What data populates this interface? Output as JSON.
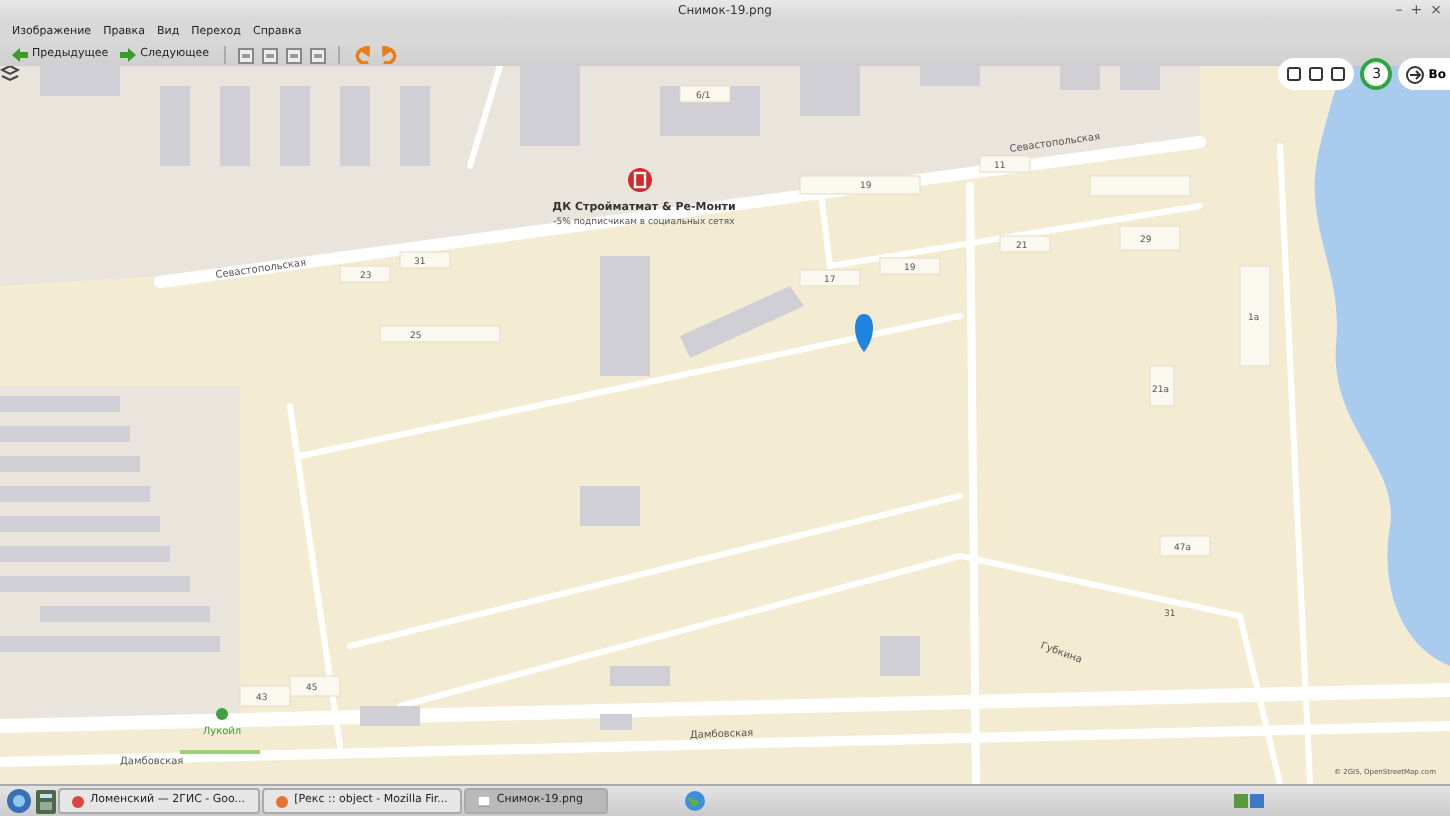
{
  "window": {
    "title": "Снимок-19.png",
    "controls": [
      "–",
      "+",
      "×"
    ]
  },
  "menu": [
    "Изображение",
    "Правка",
    "Вид",
    "Переход",
    "Справка"
  ],
  "toolbar": {
    "buttons": [
      {
        "label": "Предыдущее",
        "kind": "back"
      },
      {
        "label": "Следующее",
        "kind": "forward"
      }
    ]
  },
  "map": {
    "poi": {
      "name": "ДК Стройматмат & Ре-Монти",
      "promo": "-5% подписчикам в социальных сетях"
    },
    "streets": [
      "Севастопольская",
      "Севастопольская",
      "Дамбовская",
      "Дамбовская",
      "Губкина"
    ],
    "buildings": [
      "19",
      "11",
      "17",
      "19",
      "21",
      "25",
      "23",
      "31",
      "6/1",
      "45",
      "43",
      "47а",
      "21а",
      "1а",
      "29",
      "31"
    ],
    "place": "Лукойл",
    "zoom_badge": "3",
    "route_button": "Во",
    "attribution": "© 2GIS, OpenStreetMap.com"
  },
  "taskbar": {
    "tasks": [
      {
        "label": "Ломенский — 2ГИС - Goo...",
        "selected": false
      },
      {
        "label": "[Рекс :: object - Mozilla Fir...",
        "selected": false
      },
      {
        "label": "Снимок-19.png",
        "selected": true
      }
    ]
  }
}
